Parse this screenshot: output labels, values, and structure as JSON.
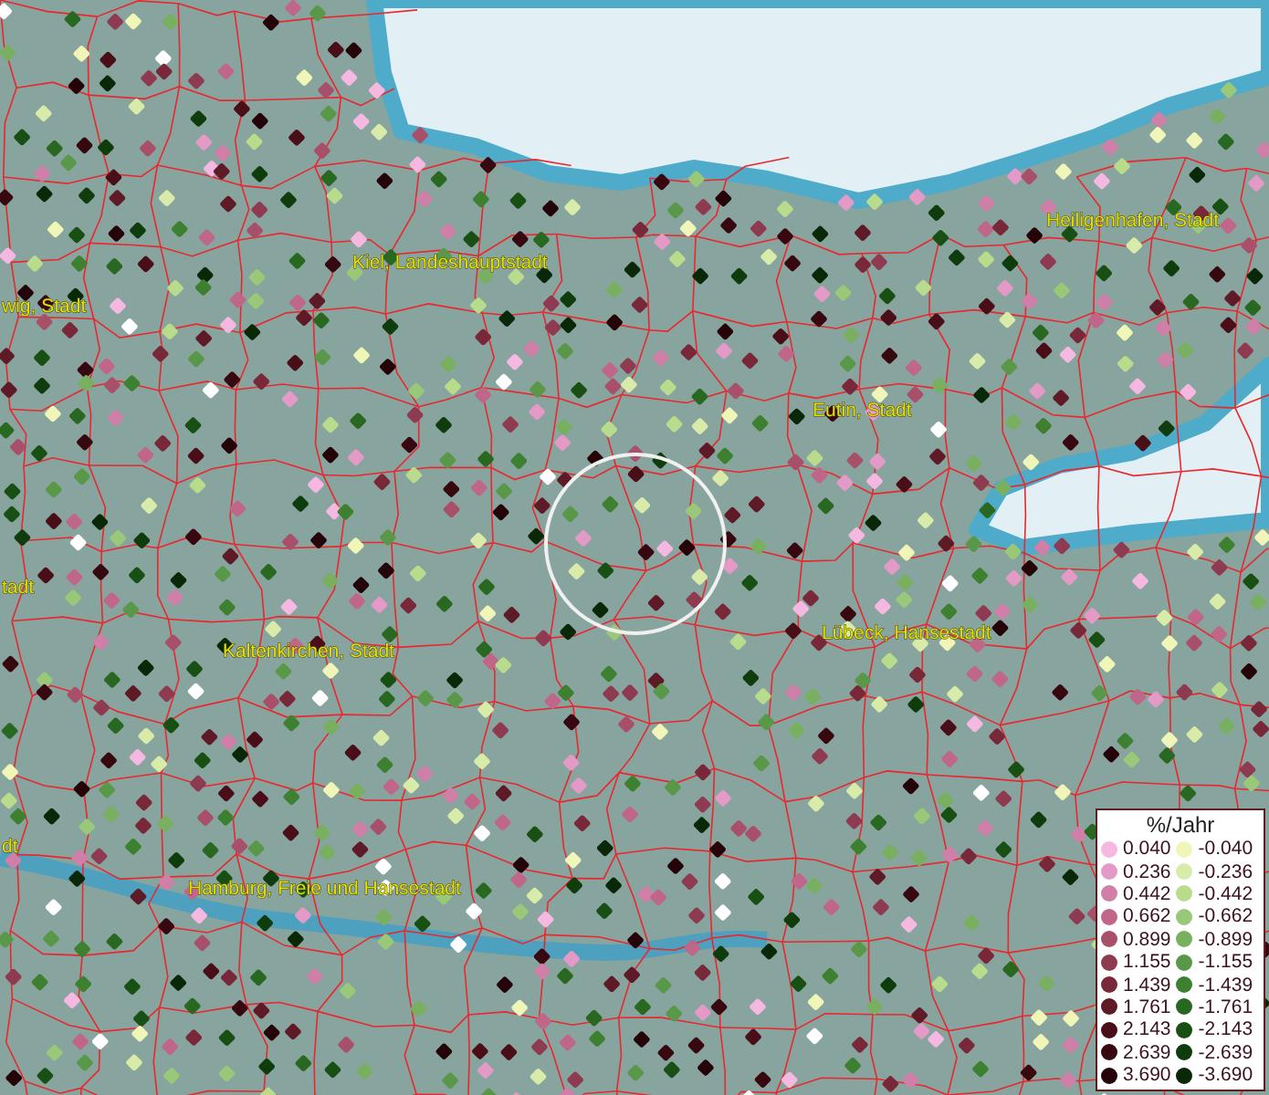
{
  "map": {
    "labels": [
      {
        "text": "wig, Stadt"
      },
      {
        "text": "Kiel, Landeshauptstadt"
      },
      {
        "text": "Heiligenhafen, Stadt"
      },
      {
        "text": "Eutin, Stadt"
      },
      {
        "text": "tadt"
      },
      {
        "text": "Kaltenkirchen, Stadt"
      },
      {
        "text": "Lübeck, Hansestadt"
      },
      {
        "text": "dt"
      },
      {
        "text": "Hamburg, Freie und Hansestadt"
      }
    ]
  },
  "legend": {
    "title": "%/Jahr",
    "columns": [
      [
        {
          "label": "0.040",
          "color": "#f5b8e0"
        },
        {
          "label": "0.236",
          "color": "#e39ac6"
        },
        {
          "label": "0.442",
          "color": "#cf7fa8"
        },
        {
          "label": "0.662",
          "color": "#c06688"
        },
        {
          "label": "0.899",
          "color": "#a8506a"
        },
        {
          "label": "1.155",
          "color": "#8e3a50"
        },
        {
          "label": "1.439",
          "color": "#782838"
        },
        {
          "label": "1.761",
          "color": "#5e1a26"
        },
        {
          "label": "2.143",
          "color": "#4a0e18"
        },
        {
          "label": "2.639",
          "color": "#380810"
        },
        {
          "label": "3.690",
          "color": "#240408"
        }
      ],
      [
        {
          "label": "-0.040",
          "color": "#f0f5b8"
        },
        {
          "label": "-0.236",
          "color": "#d8eba8"
        },
        {
          "label": "-0.442",
          "color": "#b8db8c"
        },
        {
          "label": "-0.662",
          "color": "#98c878"
        },
        {
          "label": "-0.899",
          "color": "#78b060"
        },
        {
          "label": "-1.155",
          "color": "#589848"
        },
        {
          "label": "-1.439",
          "color": "#3c8030"
        },
        {
          "label": "-1.761",
          "color": "#286820"
        },
        {
          "label": "-2.143",
          "color": "#185014"
        },
        {
          "label": "-2.639",
          "color": "#0e3c0c"
        },
        {
          "label": "-3.690",
          "color": "#082808"
        }
      ]
    ]
  }
}
